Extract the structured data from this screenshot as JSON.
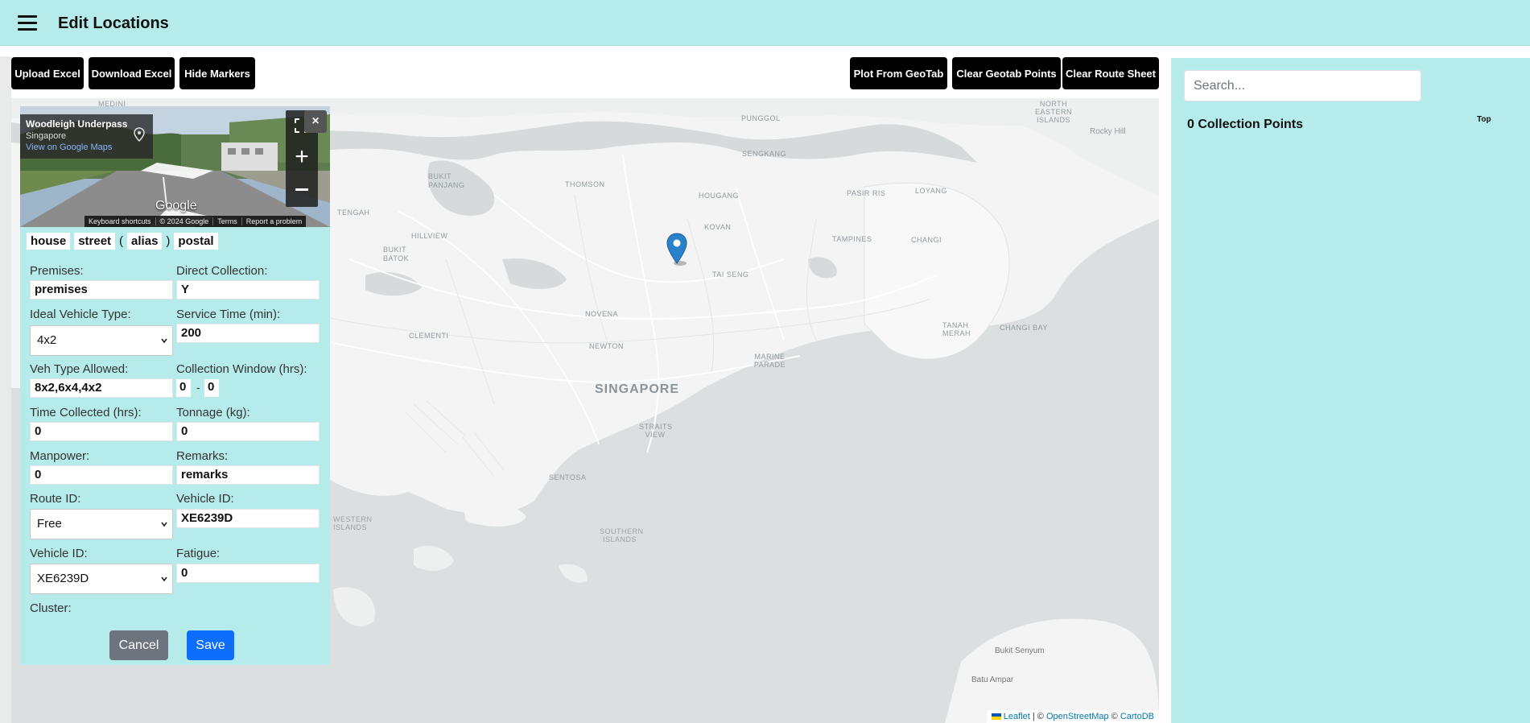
{
  "header": {
    "title": "Edit Locations",
    "menu_icon": "hamburger-menu-icon"
  },
  "toolbar": {
    "upload_excel": "Upload Excel",
    "download_excel": "Download Excel",
    "hide_markers": "Hide Markers",
    "plot_from_geotab": "Plot From GeoTab",
    "clear_geotab_points": "Clear Geotab Points",
    "clear_route_sheet": "Clear Route Sheet"
  },
  "streetview": {
    "title": "Woodleigh Underpass",
    "subtitle": "Singapore",
    "link": "View on Google Maps",
    "brand": "Google",
    "footer": [
      "Keyboard shortcuts",
      "© 2024 Google",
      "Terms",
      "Report a problem"
    ],
    "close": "×"
  },
  "address_chips": {
    "house": "house",
    "street": "street",
    "open_paren": "(",
    "alias": "alias",
    "close_paren": ")",
    "postal": "postal"
  },
  "form": {
    "premises_label": "Premises:",
    "premises_value": "premises",
    "direct_collection_label": "Direct Collection:",
    "direct_collection_value": "Y",
    "ideal_vehicle_label": "Ideal Vehicle Type:",
    "ideal_vehicle_value": "4x2",
    "service_time_label": "Service Time (min):",
    "service_time_value": "200",
    "veh_type_allowed_label": "Veh Type Allowed:",
    "veh_type_allowed_value": "8x2,6x4,4x2",
    "collection_window_label": "Collection Window (hrs):",
    "collection_window_start": "0",
    "collection_window_sep": "-",
    "collection_window_end": "0",
    "time_collected_label": "Time Collected (hrs):",
    "time_collected_value": "0",
    "tonnage_label": "Tonnage (kg):",
    "tonnage_value": "0",
    "manpower_label": "Manpower:",
    "manpower_value": "0",
    "remarks_label": "Remarks:",
    "remarks_value": "remarks",
    "route_id_label": "Route ID:",
    "route_id_value": "Free",
    "vehicle_id_label": "Vehicle ID:",
    "vehicle_id_value": "XE6239D",
    "vehicle_id_select_label": "Vehicle ID:",
    "vehicle_id_select_value": "XE6239D",
    "fatigue_label": "Fatigue:",
    "fatigue_value": "0",
    "cluster_label": "Cluster:",
    "cancel": "Cancel",
    "save": "Save"
  },
  "map": {
    "labels": {
      "medini": "MEDINI",
      "punggol": "PUNGGOL",
      "north_eastern_islands": "NORTH EASTERN ISLANDS",
      "rocky_hill": "Rocky Hill",
      "sengkang": "SENGKANG",
      "bukit_panjang": "BUKIT PANJANG",
      "thomson": "THOMSON",
      "hougang": "HOUGANG",
      "pasir_ris": "PASIR RIS",
      "loyang": "LOYANG",
      "tengah": "TENGAH",
      "kovan": "KOVAN",
      "hillview": "HILLVIEW",
      "tampines": "TAMPINES",
      "changi": "CHANGI",
      "bukit_batok": "BUKIT BATOK",
      "tai_seng": "TAI SENG",
      "novena": "NOVENA",
      "tanah_merah": "TANAH MERAH",
      "changi_bay": "CHANGI BAY",
      "clementi": "CLEMENTI",
      "newton": "NEWTON",
      "marine_parade": "MARINE PARADE",
      "singapore": "SINGAPORE",
      "straits_view": "STRAITS VIEW",
      "sentosa": "SENTOSA",
      "western_islands": "WESTERN ISLANDS",
      "southern_islands": "SOUTHERN ISLANDS",
      "bukit_senyum": "Bukit Senyum",
      "batu_ampar": "Batu Ampar"
    },
    "attribution": {
      "leaflet": "Leaflet",
      "sep1": " | © ",
      "osm": "OpenStreetMap",
      "sep2": " © ",
      "carto": "CartoDB"
    }
  },
  "right_panel": {
    "search_placeholder": "Search...",
    "collection_points": "0 Collection Points",
    "top_link": "Top"
  },
  "colors": {
    "panel_bg": "#b5ebea",
    "button_dark": "#000000",
    "save_blue": "#0d6efd",
    "cancel_gray": "#6c757d",
    "marker_blue": "#2a81cb"
  }
}
